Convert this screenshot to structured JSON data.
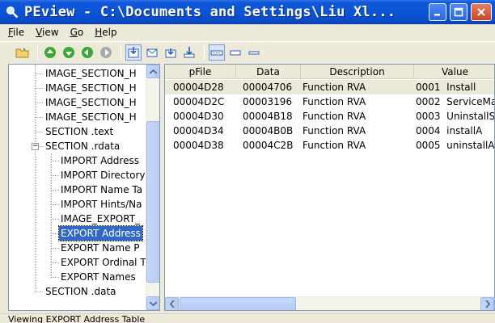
{
  "window": {
    "title": "PEview - C:\\Documents and Settings\\Liu Xl..."
  },
  "menu": {
    "items": [
      {
        "label": "File",
        "mnemonic": "F",
        "rest": "ile"
      },
      {
        "label": "View",
        "mnemonic": "V",
        "rest": "iew"
      },
      {
        "label": "Go",
        "mnemonic": "G",
        "rest": "o"
      },
      {
        "label": "Help",
        "mnemonic": "H",
        "rest": "elp"
      }
    ]
  },
  "toolbar": {
    "buttons": [
      "open-file-icon",
      "go-first-icon",
      "go-next-icon",
      "go-back-icon",
      "go-forward-icon",
      "view-raw-icon",
      "view-mail-icon",
      "view-download-icon",
      "view-import-icon",
      "view-wide-icon",
      "view-medium-icon",
      "view-narrow-icon"
    ]
  },
  "tree": {
    "items": [
      {
        "label": "IMAGE_SECTION_H",
        "level": 1
      },
      {
        "label": "IMAGE_SECTION_H",
        "level": 1
      },
      {
        "label": "IMAGE_SECTION_H",
        "level": 1
      },
      {
        "label": "IMAGE_SECTION_H",
        "level": 1
      },
      {
        "label": "SECTION .text",
        "level": 1
      },
      {
        "label": "SECTION .rdata",
        "level": 1,
        "expanded": true
      },
      {
        "label": "IMPORT Address",
        "level": 2
      },
      {
        "label": "IMPORT Directory",
        "level": 2
      },
      {
        "label": "IMPORT Name Ta",
        "level": 2
      },
      {
        "label": "IMPORT Hints/Na",
        "level": 2
      },
      {
        "label": "IMAGE_EXPORT_",
        "level": 2
      },
      {
        "label": "EXPORT Address",
        "level": 2,
        "selected": true
      },
      {
        "label": "EXPORT Name P",
        "level": 2
      },
      {
        "label": "EXPORT Ordinal T",
        "level": 2
      },
      {
        "label": "EXPORT Names",
        "level": 2
      },
      {
        "label": "SECTION .data",
        "level": 1
      }
    ]
  },
  "table": {
    "columns": [
      "pFile",
      "Data",
      "Description",
      "Value"
    ],
    "rows": [
      {
        "pfile": "00004D28",
        "data": "00004706",
        "description": "Function RVA",
        "value": "0001  Install"
      },
      {
        "pfile": "00004D2C",
        "data": "00003196",
        "description": "Function RVA",
        "value": "0002  ServiceMa"
      },
      {
        "pfile": "00004D30",
        "data": "00004B18",
        "description": "Function RVA",
        "value": "0003  UninstallS"
      },
      {
        "pfile": "00004D34",
        "data": "00004B0B",
        "description": "Function RVA",
        "value": "0004  installA"
      },
      {
        "pfile": "00004D38",
        "data": "00004C2B",
        "description": "Function RVA",
        "value": "0005  uninstallA"
      }
    ]
  },
  "status": {
    "text": "Viewing EXPORT Address Table"
  },
  "colors": {
    "title_bar": "#0b54d6",
    "selection": "#316ac5",
    "face": "#ece9d8"
  }
}
